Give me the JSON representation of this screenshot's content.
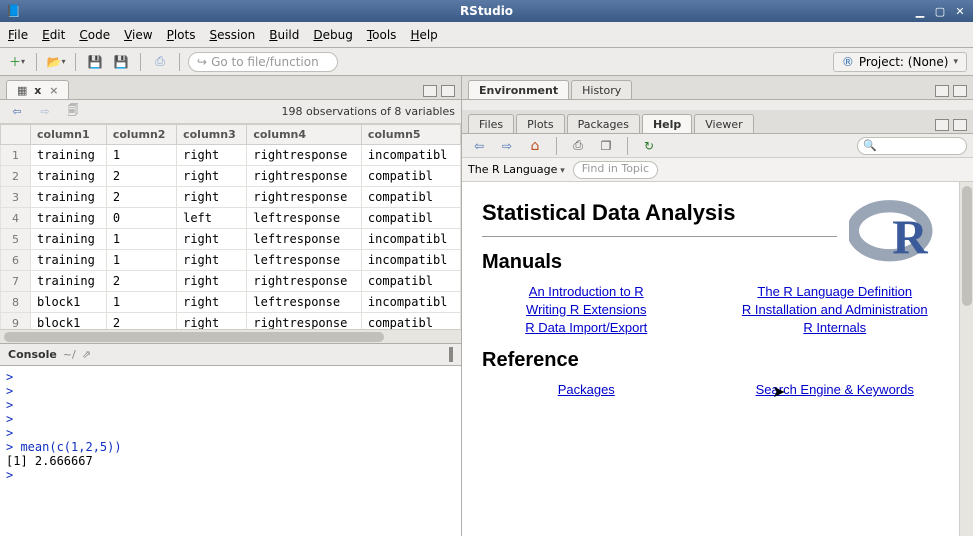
{
  "window": {
    "title": "RStudio"
  },
  "menu": [
    "File",
    "Edit",
    "Code",
    "View",
    "Plots",
    "Session",
    "Build",
    "Debug",
    "Tools",
    "Help"
  ],
  "toolbar": {
    "goto_placeholder": "Go to file/function",
    "project_label": "Project: (None)"
  },
  "source": {
    "tab_label": "x",
    "status": "198 observations of 8 variables",
    "headers": [
      "column1",
      "column2",
      "column3",
      "column4",
      "column5"
    ],
    "rows": [
      {
        "n": "1",
        "c1": "training",
        "c2": "1",
        "c3": "right",
        "c4": "rightresponse",
        "c5": "incompatibl"
      },
      {
        "n": "2",
        "c1": "training",
        "c2": "2",
        "c3": "right",
        "c4": "rightresponse",
        "c5": "compatibl"
      },
      {
        "n": "3",
        "c1": "training",
        "c2": "2",
        "c3": "right",
        "c4": "rightresponse",
        "c5": "compatibl"
      },
      {
        "n": "4",
        "c1": "training",
        "c2": "0",
        "c3": "left",
        "c4": "leftresponse",
        "c5": "compatibl"
      },
      {
        "n": "5",
        "c1": "training",
        "c2": "1",
        "c3": "right",
        "c4": "leftresponse",
        "c5": "incompatibl"
      },
      {
        "n": "6",
        "c1": "training",
        "c2": "1",
        "c3": "right",
        "c4": "leftresponse",
        "c5": "incompatibl"
      },
      {
        "n": "7",
        "c1": "training",
        "c2": "2",
        "c3": "right",
        "c4": "rightresponse",
        "c5": "compatibl"
      },
      {
        "n": "8",
        "c1": "block1",
        "c2": "1",
        "c3": "right",
        "c4": "leftresponse",
        "c5": "incompatibl"
      },
      {
        "n": "9",
        "c1": "block1",
        "c2": "2",
        "c3": "right",
        "c4": "rightresponse",
        "c5": "compatibl"
      }
    ]
  },
  "console": {
    "title": "Console",
    "path": "~/",
    "lines": [
      {
        "kind": "prompt",
        "text": ">"
      },
      {
        "kind": "prompt",
        "text": ">"
      },
      {
        "kind": "prompt",
        "text": ">"
      },
      {
        "kind": "prompt",
        "text": ">"
      },
      {
        "kind": "prompt",
        "text": ">"
      },
      {
        "kind": "prompt",
        "text": "> mean(c(1,2,5))"
      },
      {
        "kind": "out",
        "text": "[1] 2.666667"
      },
      {
        "kind": "prompt",
        "text": ">"
      }
    ]
  },
  "env_tabs": [
    "Environment",
    "History"
  ],
  "br_tabs": [
    "Files",
    "Plots",
    "Packages",
    "Help",
    "Viewer"
  ],
  "br_active": "Help",
  "help": {
    "topic_label": "The R Language",
    "find_placeholder": "Find in Topic",
    "h1": "Statistical Data Analysis",
    "h2a": "Manuals",
    "h2b": "Reference",
    "manuals_left": [
      "An Introduction to R",
      "Writing R Extensions",
      "R Data Import/Export"
    ],
    "manuals_right": [
      "The R Language Definition",
      "R Installation and Administration",
      "R Internals"
    ],
    "reference_left": [
      "Packages"
    ],
    "reference_right": [
      "Search Engine & Keywords"
    ]
  }
}
